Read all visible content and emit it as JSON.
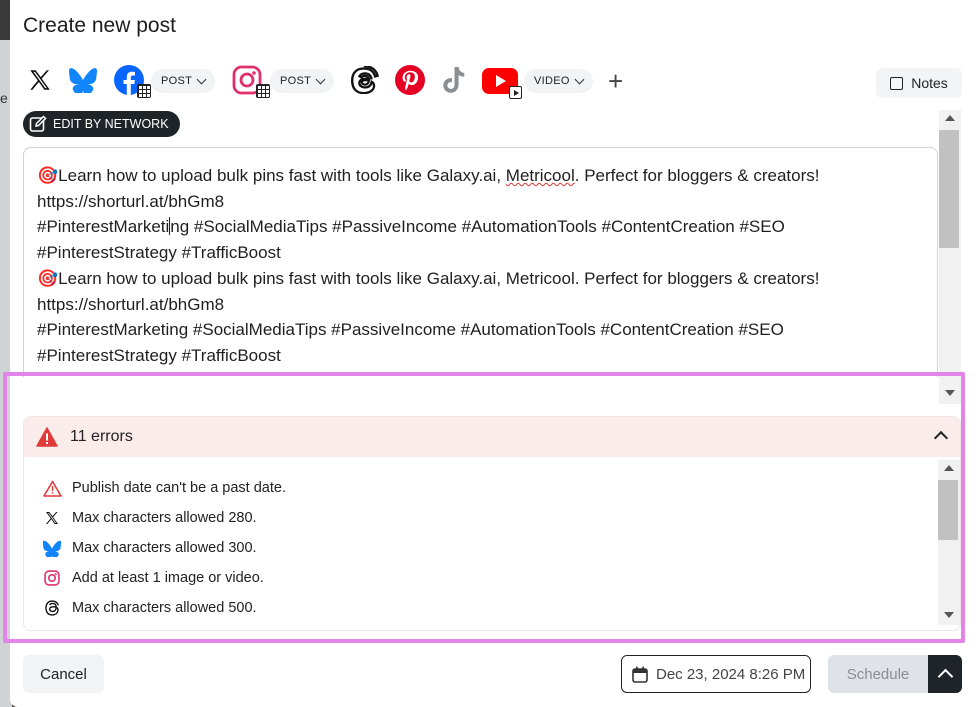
{
  "backdrop": {
    "letter": "e"
  },
  "modal": {
    "title": "Create new post"
  },
  "networks": {
    "facebook_type": "POST",
    "instagram_type": "POST",
    "youtube_type": "VIDEO"
  },
  "notes_label": "Notes",
  "edit_by_network_label": "EDIT BY NETWORK",
  "editor": {
    "line1_pre": "Learn how to upload bulk pins fast with tools like Galaxy.ai, ",
    "line1_misspelled": "Metricool",
    "line1_post": ". Perfect for bloggers & creators!",
    "line2": "https://shorturl.at/bhGm8",
    "line3_pre": "#PinterestMarketi",
    "line3_post": "ng #SocialMediaTips #PassiveIncome #AutomationTools #ContentCreation #SEO",
    "line4": "#PinterestStrategy #TrafficBoost",
    "line5": "Learn how to upload bulk pins fast with tools like Galaxy.ai, Metricool. Perfect for bloggers & creators!",
    "line6": "https://shorturl.at/bhGm8",
    "line7": "#PinterestMarketing #SocialMediaTips #PassiveIncome #AutomationTools #ContentCreation #SEO",
    "line8": "#PinterestStrategy #TrafficBoost"
  },
  "errors": {
    "count_label": "11 errors",
    "items": [
      {
        "icon": "warning-icon",
        "text": "Publish date can't be a past date."
      },
      {
        "icon": "x-twitter-icon",
        "text": "Max characters allowed 280."
      },
      {
        "icon": "bluesky-icon",
        "text": "Max characters allowed 300."
      },
      {
        "icon": "instagram-icon",
        "text": "Add at least 1 image or video."
      },
      {
        "icon": "threads-icon",
        "text": "Max characters allowed 500."
      }
    ]
  },
  "footer": {
    "cancel_label": "Cancel",
    "date_label": "Dec 23, 2024 8:26 PM",
    "schedule_label": "Schedule"
  },
  "colors": {
    "highlight": "#e385e8",
    "error_header_bg": "#fbecec",
    "warning": "#e03a3a",
    "bluesky": "#1185fe",
    "facebook": "#0866ff",
    "instagram": "#e1306c",
    "pinterest": "#e60023",
    "youtube": "#ff0000",
    "primary_dark": "#1f2428"
  }
}
